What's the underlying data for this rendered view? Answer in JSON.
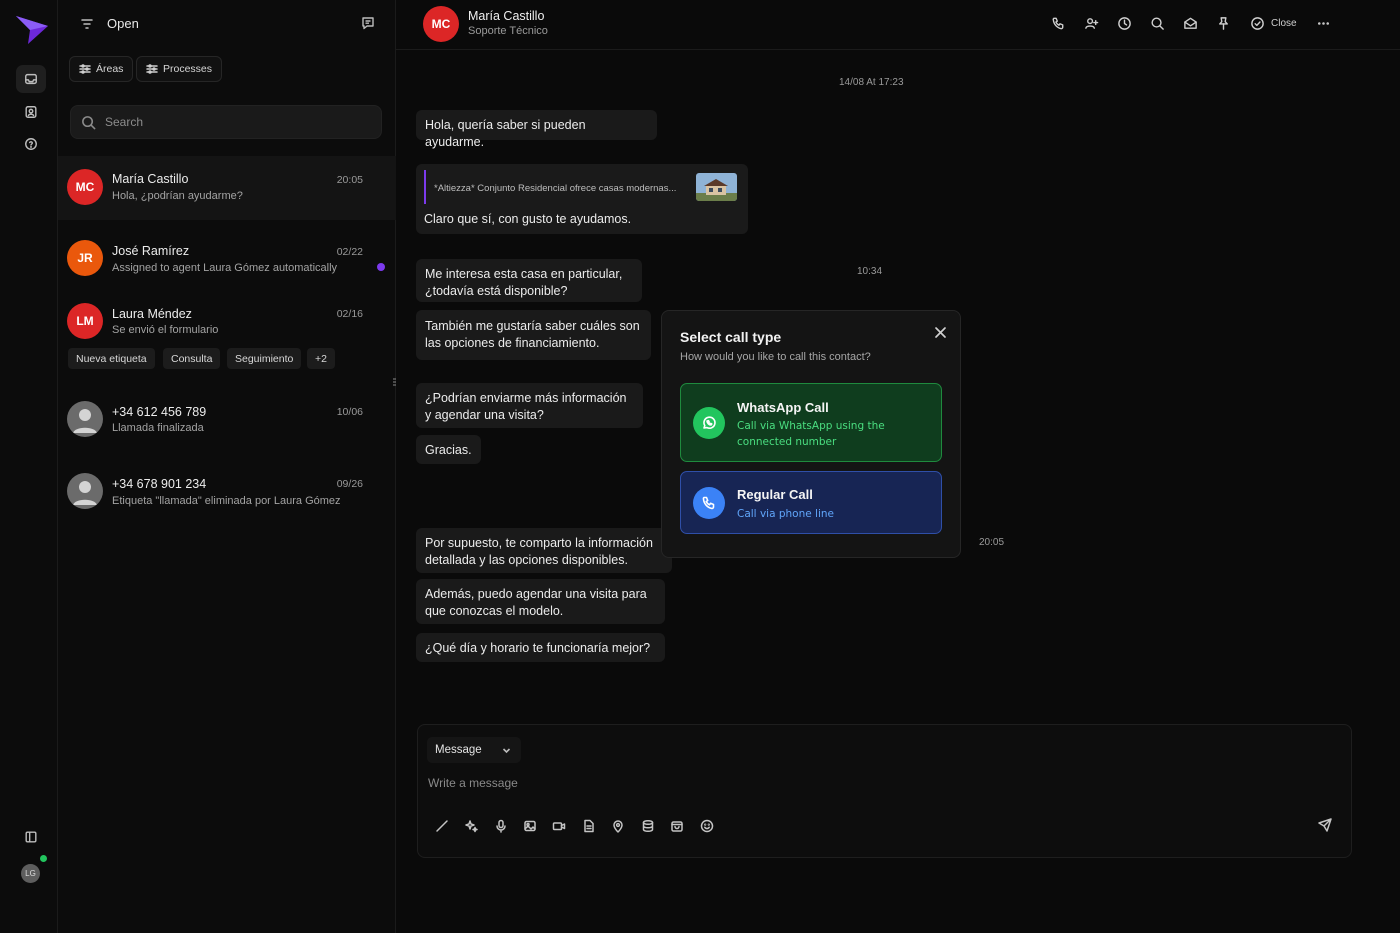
{
  "sidebar": {
    "user_initials": "LG"
  },
  "conversation_list": {
    "title": "Open",
    "filters": {
      "areas": "Áreas",
      "processes": "Processes"
    },
    "search_placeholder": "Search",
    "items": [
      {
        "initials": "MC",
        "name": "María Castillo",
        "date": "20:05",
        "preview": "Hola, ¿podrían ayudarme?",
        "avatar_color": "#dc2626"
      },
      {
        "initials": "JR",
        "name": "José Ramírez",
        "date": "02/22",
        "preview": "Assigned to agent Laura Gómez automatically",
        "avatar_color": "#ea580c"
      },
      {
        "initials": "LM",
        "name": "Laura Méndez",
        "date": "02/16",
        "preview": "Se envió el formulario",
        "avatar_color": "#dc2626",
        "tags": [
          "Nueva etiqueta",
          "Consulta",
          "Seguimiento",
          "+2"
        ]
      },
      {
        "initials": "",
        "name": "+34 612 456 789",
        "date": "10/06",
        "preview": "Llamada finalizada"
      },
      {
        "initials": "",
        "name": "+34 678 901 234",
        "date": "09/26",
        "preview": "Etiqueta \"llamada\" eliminada por Laura Gómez"
      }
    ]
  },
  "chat": {
    "contact_initials": "MC",
    "contact_name": "María Castillo",
    "contact_team": "Soporte Técnico",
    "close_label": "Close",
    "date_separator": "14/08 At 17:23",
    "messages": [
      {
        "text": "Hola, quería saber si pueden ayudarme."
      },
      {
        "quote": "*Altiezza* Conjunto Residencial ofrece casas modernas...",
        "text": "Claro que sí, con gusto te ayudamos."
      },
      {
        "text": "Me interesa esta casa en particular,\n¿todavía está disponible?",
        "time": "10:34"
      },
      {
        "text": "También me gustaría saber cuáles son\nlas opciones de financiamiento."
      },
      {
        "text": "¿Podrían enviarme más información\ny agendar una visita?"
      },
      {
        "text": "Gracias."
      },
      {
        "text": "Por supuesto, te comparto la información\ndetallada y las opciones disponibles.",
        "time": "20:05"
      },
      {
        "text": "Además, puedo agendar una visita para\nque conozcas el modelo."
      },
      {
        "text": "¿Qué día y horario te funcionaría mejor?"
      }
    ]
  },
  "composer": {
    "type_label": "Message",
    "placeholder": "Write a message"
  },
  "call_modal": {
    "title": "Select call type",
    "subtitle": "How would you like to call this contact?",
    "options": [
      {
        "title": "WhatsApp Call",
        "description": "Call via WhatsApp using the connected number"
      },
      {
        "title": "Regular Call",
        "description": "Call via phone line"
      }
    ]
  }
}
